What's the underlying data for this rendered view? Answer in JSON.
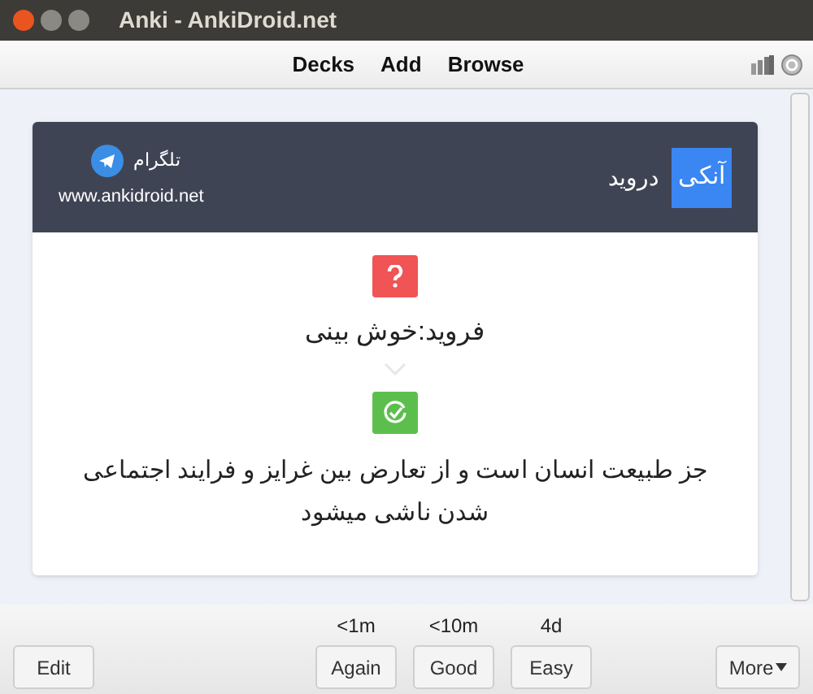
{
  "window": {
    "title": "Anki - AnkiDroid.net"
  },
  "toolbar": {
    "decks": "Decks",
    "add": "Add",
    "browse": "Browse"
  },
  "card": {
    "header": {
      "logo_badge": "آنکی",
      "logo_text": "درويد",
      "telegram_label": "تلگرام",
      "url": "www.ankidroid.net"
    },
    "question": "فروید:خوش بینی",
    "answer": "جز طبیعت انسان است و از تعارض بین غرایز و فرایند اجتماعی شدن ناشی میشود"
  },
  "bottom_bar": {
    "edit": "Edit",
    "again": {
      "interval": "<1m",
      "label": "Again"
    },
    "good": {
      "interval": "<10m",
      "label": "Good"
    },
    "easy": {
      "interval": "4d",
      "label": "Easy"
    },
    "more": "More"
  }
}
